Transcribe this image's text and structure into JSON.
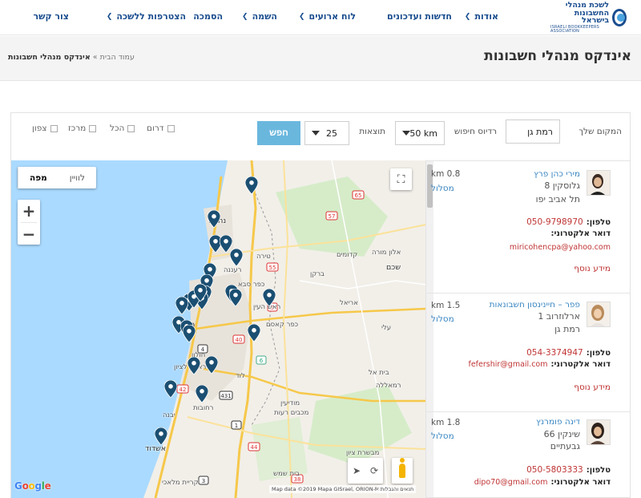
{
  "logo": {
    "line1": "לשכת מנהלי",
    "line2": "החשבונות בישראל",
    "line3": "ISRAELI BOOKKEEPERS ASSOCIATION"
  },
  "nav": {
    "about": "אודות",
    "news": "חדשות ועדכונים",
    "events": "לוח ארועים",
    "training": "השמה",
    "certification": "הסמכה",
    "join": "הצטרפות ללשכה",
    "contact": "צור קשר"
  },
  "title": {
    "page": "אינדקס מנהלי חשבונות",
    "home": "עמוד הבית",
    "current": "אינדקס מנהלי חשבונות"
  },
  "search": {
    "location_label": "המקום שלך",
    "location_value": "רמת גן",
    "radius_label": "רדיוס חיפוש",
    "radius_value": "50 km",
    "results_label": "תוצאות",
    "results_value": "25",
    "button": "חפש",
    "regions": [
      "דרום",
      "הכל",
      "מרכז",
      "צפון"
    ]
  },
  "map": {
    "type_map": "מפה",
    "type_satellite": "לוויין",
    "attribution": "Map data ©2019 Mapa GISrael, ORION-ME",
    "terms": "תנאים והגבלות",
    "google": "Google",
    "labels": [
      {
        "t": "נתניה"
      },
      {
        "t": "טירה"
      },
      {
        "t": "רעננה"
      },
      {
        "t": "שכם"
      },
      {
        "t": "כפר סבא"
      },
      {
        "t": "אריאל"
      },
      {
        "t": "ראש העין"
      },
      {
        "t": "חולון"
      },
      {
        "t": "ראשון לציון"
      },
      {
        "t": "לוד"
      },
      {
        "t": "רחובות"
      },
      {
        "t": "יבנה"
      },
      {
        "t": "מודיעין"
      },
      {
        "t": "מכבים רעות"
      },
      {
        "t": "אשדוד"
      },
      {
        "t": "בית שמש"
      },
      {
        "t": "קריית מלאכי"
      },
      {
        "t": "קדומים"
      },
      {
        "t": "אלון מורה"
      },
      {
        "t": "ברקן"
      },
      {
        "t": "עלי"
      },
      {
        "t": "רמאללה"
      },
      {
        "t": "בית אל"
      },
      {
        "t": "כפר קאסם"
      },
      {
        "t": "מבשרת ציון"
      }
    ],
    "road_numbers": [
      "57",
      "55",
      "5",
      "40",
      "431",
      "1",
      "6",
      "2",
      "4",
      "42",
      "3",
      "38",
      "44",
      "65"
    ]
  },
  "results": [
    {
      "name": "מירי כהן פרץ",
      "distance": "0.8 km",
      "route": "מסלול",
      "address": "גלוסקין 8",
      "city": "תל אביב יפו",
      "phone_label": "טלפון:",
      "phone": "050-9798970",
      "email_label": "דואר אלקטרוני:",
      "email": "miricohencpa@yahoo.com",
      "more": "מידע נוסף"
    },
    {
      "name": "פפר – חיינינסון חשבונאות",
      "distance": "1.5 km",
      "route": "מסלול",
      "address": "ארלוזרוב 1",
      "city": "רמת גן",
      "phone_label": "טלפון:",
      "phone": "054-3374947",
      "email_label": "דואר אלקטרוני:",
      "email": "fefershir@gmail.com",
      "more": "מידע נוסף"
    },
    {
      "name": "דינה פומרנץ",
      "distance": "1.8 km",
      "route": "מסלול",
      "address": "שינקין 66",
      "city": "גבעתיים",
      "phone_label": "טלפון:",
      "phone": "050-5803333",
      "email_label": "דואר אלקטרוני:",
      "email": "dipo70@gmail.com",
      "more": ""
    }
  ],
  "colors": {
    "brand": "#1a4d8f",
    "link": "#3a86c2",
    "accent_red": "#c03434",
    "search_button": "#6ab7de",
    "pin": "#1b4f72"
  }
}
